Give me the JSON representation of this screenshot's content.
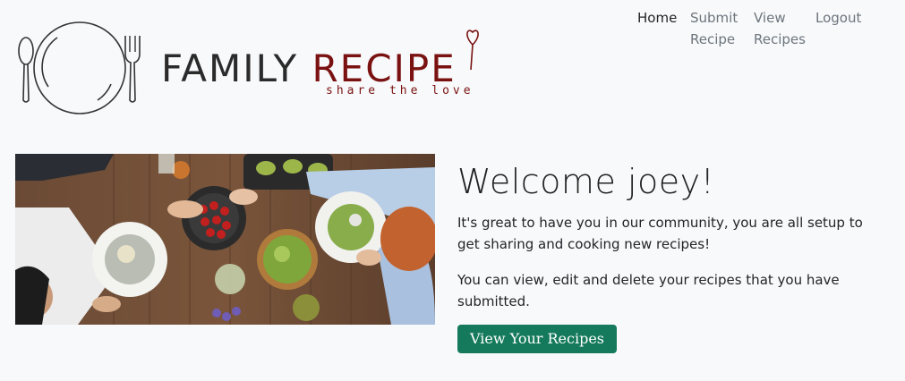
{
  "brand": {
    "word1": "FAMILY",
    "word2": "RECIPE",
    "tagline": "share the love",
    "colors": {
      "dark": "#2b2b2b",
      "accent": "#7a1212"
    }
  },
  "nav": {
    "items": [
      {
        "label": "Home"
      },
      {
        "label": "Submit Recipe"
      },
      {
        "label": "View Recipes"
      },
      {
        "label": "Logout"
      }
    ]
  },
  "welcome": {
    "title": "Welcome joey!",
    "paragraph1": "It's great to have you in our community, you are all setup to get sharing and cooking new recipes!",
    "paragraph2": "You can view, edit and delete your recipes that you have submitted.",
    "button_label": "View Your Recipes"
  },
  "colors": {
    "button": "#157a5c",
    "background": "#f8f9fa"
  }
}
